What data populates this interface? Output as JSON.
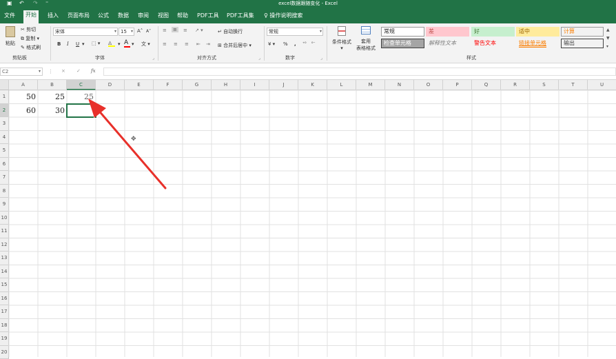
{
  "title_bar": {
    "title": "excel数据跟随变化 - Excel"
  },
  "tabs": [
    "文件",
    "开始",
    "插入",
    "页面布局",
    "公式",
    "数据",
    "审阅",
    "视图",
    "帮助",
    "PDF工具",
    "PDF工具集",
    "操作说明搜索"
  ],
  "ribbon": {
    "clipboard": {
      "paste": "粘贴",
      "cut": "剪切",
      "copy": "复制",
      "format_painter": "格式刷",
      "label": "剪贴板"
    },
    "font": {
      "name": "宋体",
      "size": "15",
      "bold": "B",
      "italic": "I",
      "underline": "U",
      "grow": "A",
      "shrink": "A",
      "label": "字体"
    },
    "alignment": {
      "wrap": "自动换行",
      "merge": "合并后居中",
      "label": "对齐方式"
    },
    "number": {
      "format": "常规",
      "percent": "%",
      "comma": ",",
      "label": "数字"
    },
    "styles": {
      "conditional": "条件格式",
      "table_line1": "套用",
      "table_line2": "表格格式",
      "label": "样式",
      "cells": [
        {
          "text": "常规",
          "bg": "#ffffff",
          "color": "#222222",
          "border": "#9a9a9a"
        },
        {
          "text": "差",
          "bg": "#ffc7ce",
          "color": "#c0504d",
          "border": "#ffc7ce"
        },
        {
          "text": "好",
          "bg": "#c6efce",
          "color": "#4a7a3a",
          "border": "#c6efce"
        },
        {
          "text": "适中",
          "bg": "#ffeb9c",
          "color": "#9c6500",
          "border": "#ffeb9c"
        },
        {
          "text": "计算",
          "bg": "#f2f2f2",
          "color": "#fa7d00",
          "border": "#9a9a9a"
        },
        {
          "text": "检查单元格",
          "bg": "#a5a5a5",
          "color": "#ffffff",
          "border": "#3f3f3f"
        },
        {
          "text": "解释性文本",
          "bg": "#f3f3f3",
          "color": "#7f7f7f",
          "border": "#f3f3f3"
        },
        {
          "text": "警告文本",
          "bg": "#f3f3f3",
          "color": "#ff0000",
          "border": "#f3f3f3"
        },
        {
          "text": "链接单元格",
          "bg": "#f3f3f3",
          "color": "#fa7d00",
          "border": "#f3f3f3"
        },
        {
          "text": "输出",
          "bg": "#f2f2f2",
          "color": "#3f3f3f",
          "border": "#3f3f3f"
        }
      ]
    }
  },
  "formula_bar": {
    "name_box": "C2",
    "cancel": "×",
    "enter": "✓",
    "fx": "fx",
    "value": ""
  },
  "columns": [
    "A",
    "B",
    "C",
    "D",
    "E",
    "F",
    "G",
    "H",
    "I",
    "J",
    "K",
    "L",
    "M",
    "N",
    "O",
    "P",
    "Q",
    "R",
    "S",
    "T",
    "U"
  ],
  "rows": [
    "1",
    "2",
    "3",
    "4",
    "5",
    "6",
    "7",
    "8",
    "9",
    "10",
    "11",
    "12",
    "13",
    "14",
    "15",
    "16",
    "17",
    "18",
    "19",
    "20"
  ],
  "cells": [
    {
      "ref": "A1",
      "value": "50"
    },
    {
      "ref": "B1",
      "value": "25"
    },
    {
      "ref": "C1",
      "value": "25"
    },
    {
      "ref": "A2",
      "value": "60"
    },
    {
      "ref": "B2",
      "value": "30"
    }
  ],
  "selected_cell": "C2",
  "accent_color": "#217346",
  "annotation_color": "#e8302a"
}
